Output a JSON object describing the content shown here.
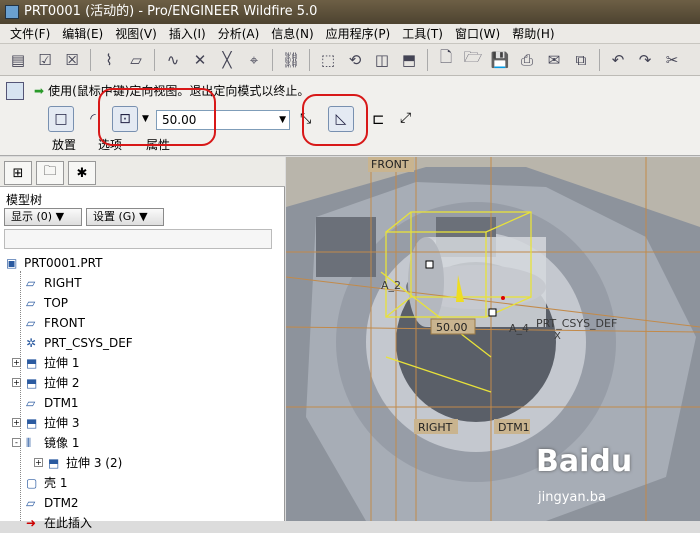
{
  "window": {
    "title": "PRT0001 (活动的) - Pro/ENGINEER Wildfire 5.0"
  },
  "menu": [
    "文件(F)",
    "编辑(E)",
    "视图(V)",
    "插入(I)",
    "分析(A)",
    "信息(N)",
    "应用程序(P)",
    "工具(T)",
    "窗口(W)",
    "帮助(H)"
  ],
  "dashboard": {
    "hint": "使用(鼠标中键)定向视图。退出定向模式以终止。",
    "value": "50.00",
    "tabs": [
      "放置",
      "选项",
      "属性"
    ]
  },
  "panel": {
    "title": "模型树",
    "show_btn": "显示 (0) ▼",
    "settings_btn": "设置 (G) ▼",
    "tree": [
      {
        "label": "PRT0001.PRT",
        "indent": 0,
        "icon": "part-icon"
      },
      {
        "label": "RIGHT",
        "indent": 1,
        "icon": "datum-plane-icon"
      },
      {
        "label": "TOP",
        "indent": 1,
        "icon": "datum-plane-icon"
      },
      {
        "label": "FRONT",
        "indent": 1,
        "icon": "datum-plane-icon"
      },
      {
        "label": "PRT_CSYS_DEF",
        "indent": 1,
        "icon": "csys-icon"
      },
      {
        "label": "拉伸 1",
        "indent": 1,
        "icon": "extrude-icon",
        "exp": "+"
      },
      {
        "label": "拉伸 2",
        "indent": 1,
        "icon": "extrude-icon",
        "exp": "+"
      },
      {
        "label": "DTM1",
        "indent": 1,
        "icon": "datum-plane-icon"
      },
      {
        "label": "拉伸 3",
        "indent": 1,
        "icon": "extrude-icon",
        "exp": "+"
      },
      {
        "label": "镜像 1",
        "indent": 1,
        "icon": "mirror-icon",
        "exp": "-"
      },
      {
        "label": "拉伸 3 (2)",
        "indent": 2,
        "icon": "extrude-icon",
        "exp": "+"
      },
      {
        "label": "壳 1",
        "indent": 1,
        "icon": "shell-icon"
      },
      {
        "label": "DTM2",
        "indent": 1,
        "icon": "datum-plane-icon"
      },
      {
        "label": "在此插入",
        "indent": 1,
        "icon": "insert-here-icon"
      }
    ]
  },
  "viewport": {
    "labels": {
      "front": "FRONT",
      "right": "RIGHT",
      "dtm1": "DTM1",
      "csys": "PRT_CSYS_DEF",
      "a2": "A_2",
      "a4": "A_4",
      "x": "X",
      "dim": "50.00"
    }
  },
  "watermark": {
    "brand": "Baidu",
    "site": "jingyan.ba"
  }
}
